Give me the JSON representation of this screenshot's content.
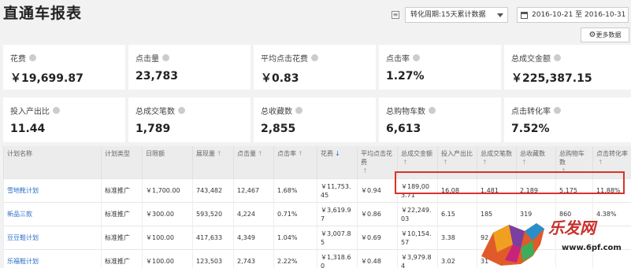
{
  "page_title": "直通车报表",
  "period": {
    "label": "转化周期:15天累计数据"
  },
  "date_range": "2016-10-21 至 2016-10-31",
  "more_data_label": "更多数据",
  "cards": [
    {
      "label": "花费",
      "value": "￥19,699.87"
    },
    {
      "label": "点击量",
      "value": "23,783"
    },
    {
      "label": "平均点击花费",
      "value": "￥0.83"
    },
    {
      "label": "点击率",
      "value": "1.27%"
    },
    {
      "label": "总成交金额",
      "value": "￥225,387.15"
    },
    {
      "label": "投入产出比",
      "value": "11.44"
    },
    {
      "label": "总成交笔数",
      "value": "1,789"
    },
    {
      "label": "总收藏数",
      "value": "2,855"
    },
    {
      "label": "总购物车数",
      "value": "6,613"
    },
    {
      "label": "点击转化率",
      "value": "7.52%"
    }
  ],
  "table": {
    "headers": [
      "计划名称",
      "计划类型",
      "日限额",
      "展现量",
      "点击量",
      "点击率",
      "花费",
      "平均点击花费",
      "总成交金额",
      "投入产出比",
      "总成交笔数",
      "总收藏数",
      "总购物车数",
      "点击转化率"
    ],
    "rows": [
      [
        "雪地靴计划",
        "标准推广",
        "￥1,700.00",
        "743,482",
        "12,467",
        "1.68%",
        "￥11,753.45",
        "￥0.94",
        "￥189,003.71",
        "16.08",
        "1,481",
        "2,189",
        "5,175",
        "11.88%"
      ],
      [
        "新品三款",
        "标准推广",
        "￥300.00",
        "593,520",
        "4,224",
        "0.71%",
        "￥3,619.97",
        "￥0.86",
        "￥22,249.03",
        "6.15",
        "185",
        "319",
        "860",
        "4.38%"
      ],
      [
        "豆豆鞋计划",
        "标准推广",
        "￥100.00",
        "417,633",
        "4,349",
        "1.04%",
        "￥3,007.85",
        "￥0.69",
        "￥10,154.57",
        "3.38",
        "92",
        "",
        "",
        ""
      ],
      [
        "乐福鞋计划",
        "标准推广",
        "￥100.00",
        "123,503",
        "2,743",
        "2.22%",
        "￥1,318.60",
        "￥0.48",
        "￥3,979.84",
        "3.02",
        "31",
        "",
        "",
        ""
      ]
    ]
  },
  "watermark": {
    "text": "乐发网",
    "url": "www.6pf.com"
  }
}
